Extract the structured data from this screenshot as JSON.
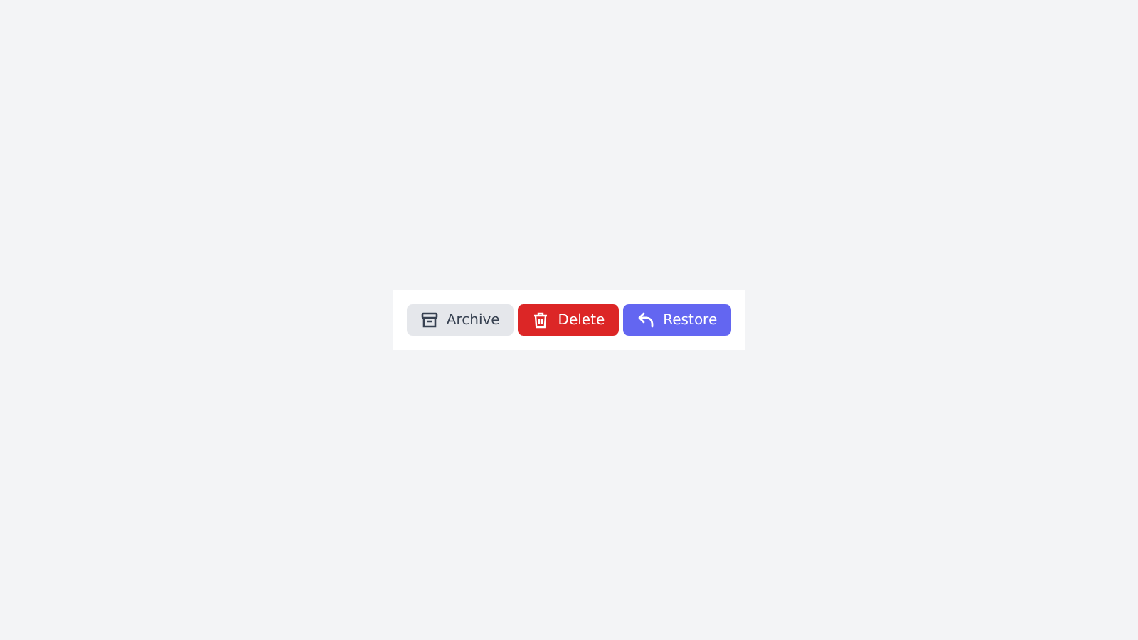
{
  "buttons": [
    {
      "label": "Archive",
      "kind": "archive"
    },
    {
      "label": "Delete",
      "kind": "delete"
    },
    {
      "label": "Restore",
      "kind": "restore"
    }
  ]
}
